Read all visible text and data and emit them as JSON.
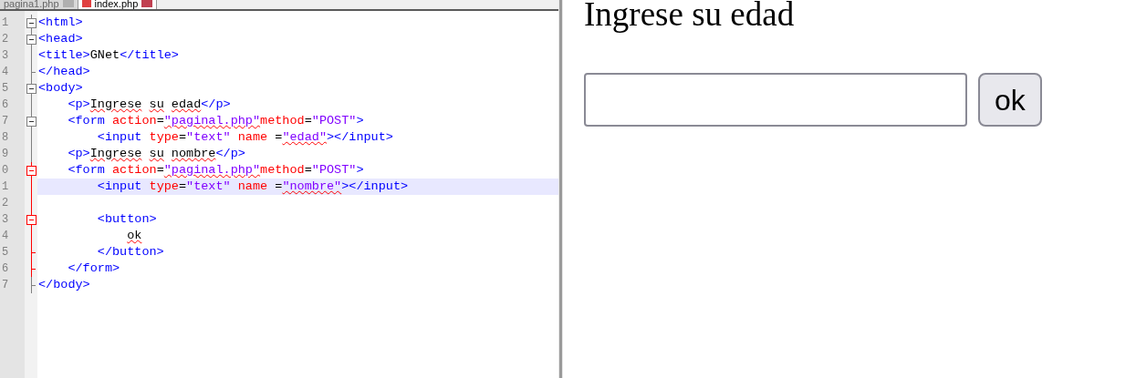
{
  "tabs": [
    {
      "label": "pagina1.php",
      "selected": false
    },
    {
      "label": "index.php",
      "selected": true
    }
  ],
  "editor": {
    "lines": [
      {
        "number": "1",
        "kind": "fold-start",
        "active": false,
        "current": false,
        "tokens": [
          {
            "kind": "tag",
            "text": "<html>"
          }
        ]
      },
      {
        "number": "2",
        "kind": "fold-start",
        "active": false,
        "current": false,
        "tokens": [
          {
            "kind": "tag",
            "text": "<head>"
          }
        ]
      },
      {
        "number": "3",
        "kind": "fold-body",
        "active": false,
        "current": false,
        "tokens": [
          {
            "kind": "tag",
            "text": "<title>"
          },
          {
            "kind": "text",
            "text": "GNet"
          },
          {
            "kind": "tag",
            "text": "</title>"
          }
        ]
      },
      {
        "number": "4",
        "kind": "fold-end",
        "active": false,
        "current": false,
        "tokens": [
          {
            "kind": "tag",
            "text": "</head>"
          }
        ]
      },
      {
        "number": "5",
        "kind": "fold-start",
        "active": false,
        "current": false,
        "tokens": [
          {
            "kind": "tag",
            "text": "<body>"
          }
        ]
      },
      {
        "number": "6",
        "kind": "fold-body",
        "active": false,
        "current": false,
        "tokens": [
          {
            "kind": "tag",
            "text": "    <p>"
          },
          {
            "kind": "text",
            "text": "Ingrese",
            "misspelled": true
          },
          {
            "kind": "text",
            "text": " su",
            "misspelled": true
          },
          {
            "kind": "text",
            "text": " edad",
            "misspelled": true
          },
          {
            "kind": "tag",
            "text": "</p>"
          }
        ]
      },
      {
        "number": "7",
        "kind": "fold-start",
        "active": false,
        "current": false,
        "tokens": [
          {
            "kind": "tag",
            "text": "    <form "
          },
          {
            "kind": "attr",
            "text": "action"
          },
          {
            "kind": "text",
            "text": "="
          },
          {
            "kind": "string",
            "text": "\"paginal.php\"",
            "misspelled": true
          },
          {
            "kind": "attr",
            "text": "method"
          },
          {
            "kind": "text",
            "text": "="
          },
          {
            "kind": "string",
            "text": "\"POST\""
          },
          {
            "kind": "tag",
            "text": ">"
          }
        ]
      },
      {
        "number": "8",
        "kind": "fold-body",
        "active": false,
        "current": false,
        "tokens": [
          {
            "kind": "tag",
            "text": "        <input "
          },
          {
            "kind": "attr",
            "text": "type"
          },
          {
            "kind": "text",
            "text": "="
          },
          {
            "kind": "string",
            "text": "\"text\""
          },
          {
            "kind": "attr",
            "text": " name "
          },
          {
            "kind": "text",
            "text": "="
          },
          {
            "kind": "string",
            "text": "\"edad\"",
            "misspelled": true
          },
          {
            "kind": "tag",
            "text": "></input>"
          }
        ]
      },
      {
        "number": "9",
        "kind": "fold-body",
        "active": false,
        "current": false,
        "tokens": [
          {
            "kind": "tag",
            "text": "    <p>"
          },
          {
            "kind": "text",
            "text": "Ingrese",
            "misspelled": true
          },
          {
            "kind": "text",
            "text": " su",
            "misspelled": true
          },
          {
            "kind": "text",
            "text": " nombre",
            "misspelled": true
          },
          {
            "kind": "tag",
            "text": "</p>"
          }
        ]
      },
      {
        "number": "0",
        "kind": "fold-start",
        "active": true,
        "current": false,
        "tokens": [
          {
            "kind": "tag",
            "text": "    <form "
          },
          {
            "kind": "attr",
            "text": "action"
          },
          {
            "kind": "text",
            "text": "="
          },
          {
            "kind": "string",
            "text": "\"paginal.php\"",
            "misspelled": true
          },
          {
            "kind": "attr",
            "text": "method"
          },
          {
            "kind": "text",
            "text": "="
          },
          {
            "kind": "string",
            "text": "\"POST\""
          },
          {
            "kind": "tag",
            "text": ">"
          }
        ]
      },
      {
        "number": "1",
        "kind": "fold-body",
        "active": true,
        "current": true,
        "tokens": [
          {
            "kind": "tag",
            "text": "        <input "
          },
          {
            "kind": "attr",
            "text": "type"
          },
          {
            "kind": "text",
            "text": "="
          },
          {
            "kind": "string",
            "text": "\"text\""
          },
          {
            "kind": "attr",
            "text": " name "
          },
          {
            "kind": "text",
            "text": "="
          },
          {
            "kind": "string",
            "text": "\"nombre\"",
            "misspelled": true
          },
          {
            "kind": "tag",
            "text": "></input>"
          }
        ]
      },
      {
        "number": "2",
        "kind": "fold-body",
        "active": true,
        "current": false
      },
      {
        "number": "3",
        "kind": "fold-start",
        "active": true,
        "current": false,
        "tokens": [
          {
            "kind": "tag",
            "text": "        <button>"
          }
        ]
      },
      {
        "number": "4",
        "kind": "fold-body",
        "active": true,
        "current": false,
        "tokens": [
          {
            "kind": "text",
            "text": "            ok",
            "misspelled": true
          }
        ]
      },
      {
        "number": "5",
        "kind": "fold-end",
        "active": true,
        "current": false,
        "tokens": [
          {
            "kind": "tag",
            "text": "        </button>"
          }
        ]
      },
      {
        "number": "6",
        "kind": "fold-end",
        "active": true,
        "current": false,
        "tokens": [
          {
            "kind": "tag",
            "text": "    </form>"
          }
        ]
      },
      {
        "number": "7",
        "kind": "fold-end",
        "active": false,
        "current": false,
        "tokens": [
          {
            "kind": "tag",
            "text": "</body>"
          }
        ]
      }
    ]
  },
  "preview": {
    "heading": "Ingrese su edad",
    "button": "ok"
  }
}
